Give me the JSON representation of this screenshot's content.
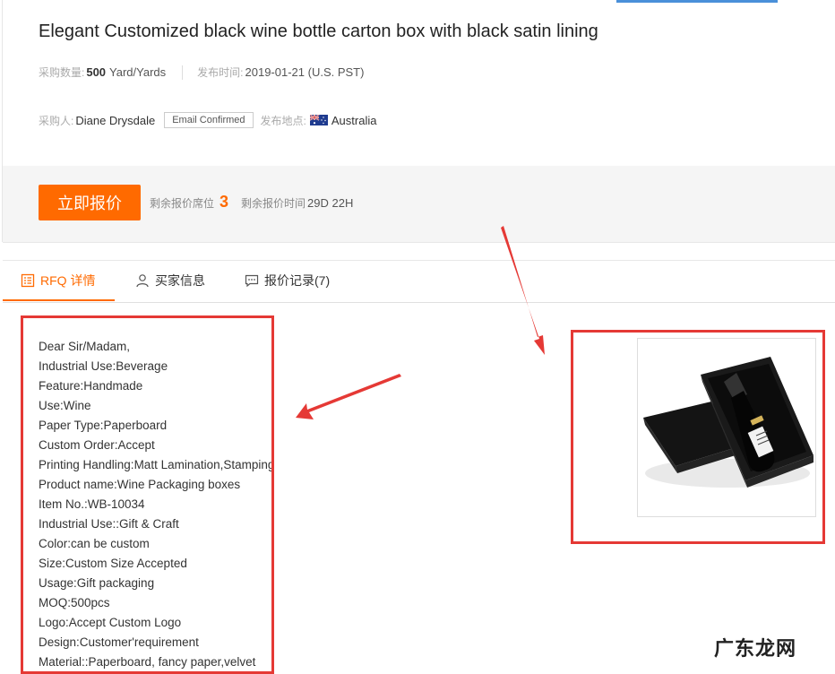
{
  "rfq": {
    "title": "Elegant Customized black wine bottle carton box with black satin lining",
    "quantity_label": "采购数量:",
    "quantity_value": "500",
    "quantity_unit": "Yard/Yards",
    "posted_label": "发布时间:",
    "posted_value": "2019-01-21 (U.S. PST)",
    "buyer_label": "采购人:",
    "buyer_name": "Diane Drysdale",
    "email_badge": "Email Confirmed",
    "location_label": "发布地点:",
    "location_value": "Australia",
    "flag_icon": "australia-flag-icon"
  },
  "actions": {
    "quote_button": "立即报价",
    "remaining_seats_label": "剩余报价席位",
    "remaining_seats_value": "3",
    "remaining_time_label": "剩余报价时间",
    "remaining_time_value": "29D 22H"
  },
  "tabs": [
    {
      "label": "RFQ 详情",
      "icon": "document-list-icon",
      "active": true
    },
    {
      "label": "买家信息",
      "icon": "user-icon",
      "active": false
    },
    {
      "label": "报价记录(7)",
      "icon": "chat-bubble-icon",
      "active": false
    }
  ],
  "details": [
    "Dear Sir/Madam,",
    "Industrial Use:Beverage",
    "Feature:Handmade",
    "Use:Wine",
    "Paper Type:Paperboard",
    "Custom Order:Accept",
    "Printing Handling:Matt Lamination,Stamping",
    "Product name:Wine Packaging boxes",
    "Item No.:WB-10034",
    "Industrial Use::Gift & Craft",
    "Color:can be custom",
    "Size:Custom Size Accepted",
    "Usage:Gift packaging",
    "MOQ:500pcs",
    "Logo:Accept Custom Logo",
    "Design:Customer'requirement",
    "Material::Paperboard, fancy paper,velvet"
  ],
  "watermark": "广东龙网",
  "colors": {
    "accent_orange": "#ff6a00",
    "annotation_red": "#e53935",
    "top_accent_blue": "#4a90d9"
  }
}
